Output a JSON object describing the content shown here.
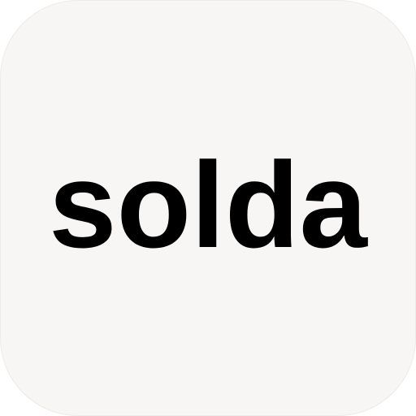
{
  "app_icon": {
    "wordmark": "solda",
    "background_color": "#f7f6f4",
    "text_color": "#000000"
  }
}
